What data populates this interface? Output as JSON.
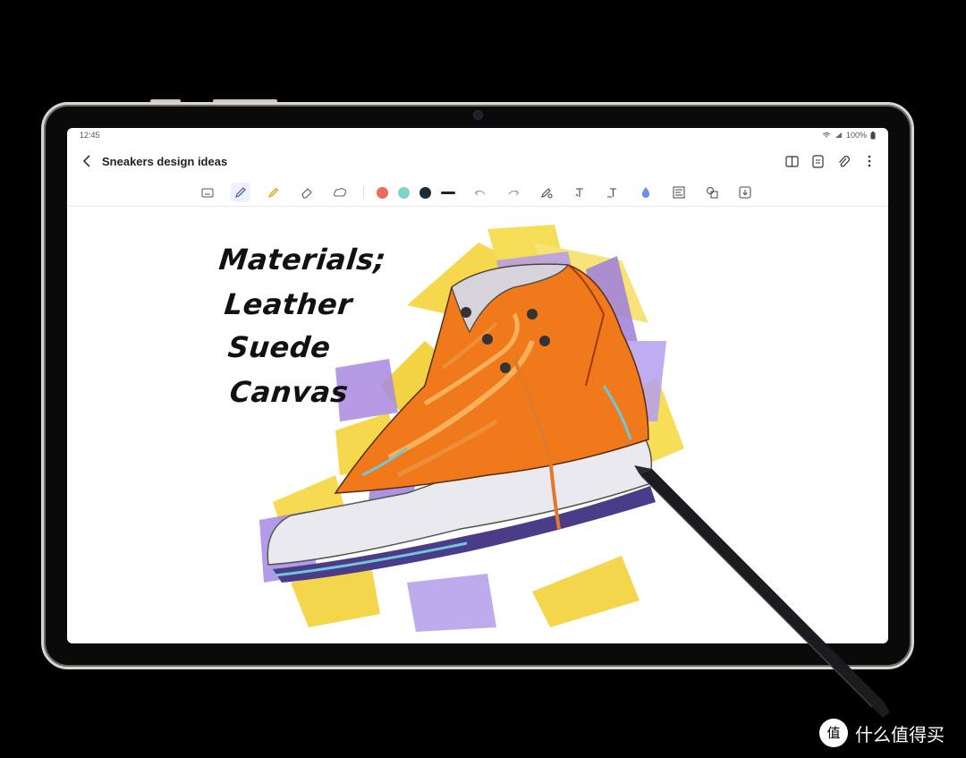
{
  "status_bar": {
    "time": "12:45",
    "battery": "100%"
  },
  "header": {
    "title": "Sneakers design ideas",
    "actions": [
      "book-view-icon",
      "page-template-icon",
      "attach-icon",
      "more-icon"
    ]
  },
  "toolbar": {
    "tools": [
      "keyboard-icon",
      "pen-icon",
      "highlighter-icon",
      "eraser-icon",
      "lasso-icon"
    ],
    "active_tool": "pen-icon",
    "colors": [
      "#ee6b5e",
      "#7fd3c7",
      "#1d2a3a"
    ],
    "actions": [
      "undo-icon",
      "redo-icon",
      "pen-settings-icon",
      "text-tool-icon",
      "text-style-icon",
      "fill-icon",
      "insert-image-icon",
      "shapes-icon",
      "audio-icon"
    ]
  },
  "note": {
    "handwriting": [
      "Materials;",
      "Leather",
      "Suede",
      "Canvas"
    ]
  },
  "watermark": {
    "text": "什么值得买"
  }
}
